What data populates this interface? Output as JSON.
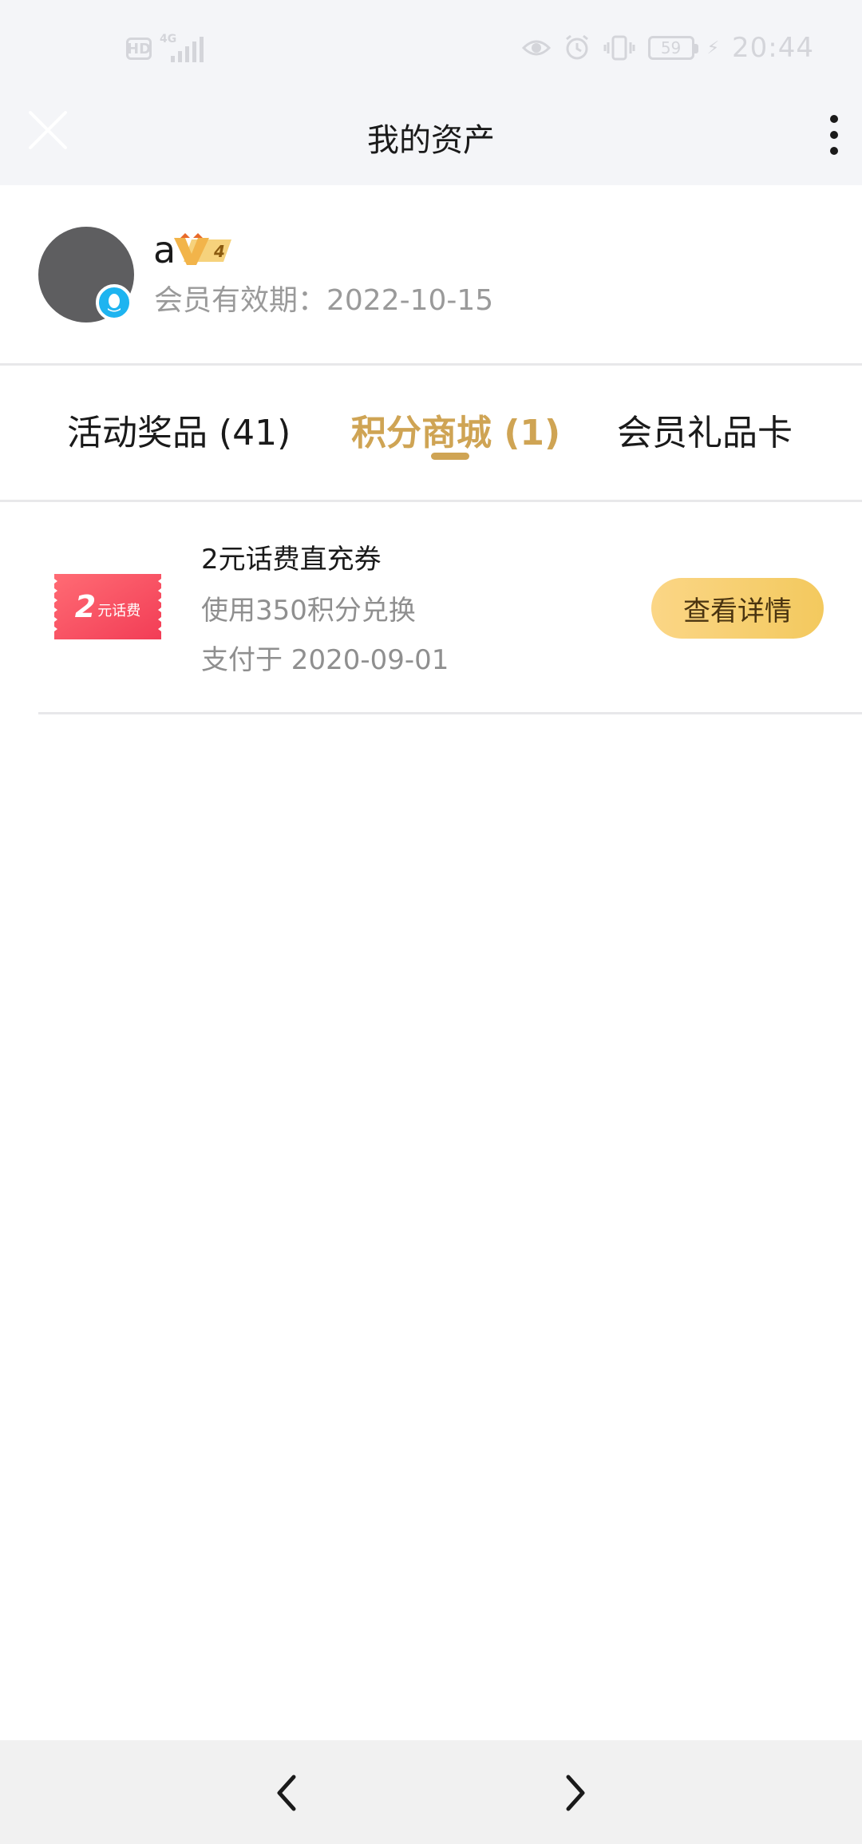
{
  "status_bar": {
    "hd_label": "HD",
    "network_label": "4G",
    "battery_level": "59",
    "time": "20:44"
  },
  "header": {
    "title": "我的资产"
  },
  "profile": {
    "name": "a",
    "vip_level": "4",
    "membership_expiry": "会员有效期：2022-10-15"
  },
  "tabs": [
    {
      "label": "活动奖品 (41)",
      "active": false
    },
    {
      "label": "积分商城 (1)",
      "active": true
    },
    {
      "label": "会员礼品卡",
      "active": false
    }
  ],
  "items": [
    {
      "coupon_number": "2",
      "coupon_label": "元话费",
      "title": "2元话费直充券",
      "description": "使用350积分兑换",
      "date": "支付于 2020-09-01",
      "button_label": "查看详情"
    }
  ],
  "colors": {
    "accent": "#cfa454",
    "button_gold": "#f3c95e",
    "coupon_red": "#ff5566",
    "qq_blue": "#1eb4f0"
  },
  "icons": {
    "close": "close-icon",
    "more": "more-vertical-icon",
    "back": "chevron-left-icon",
    "forward": "chevron-right-icon"
  }
}
